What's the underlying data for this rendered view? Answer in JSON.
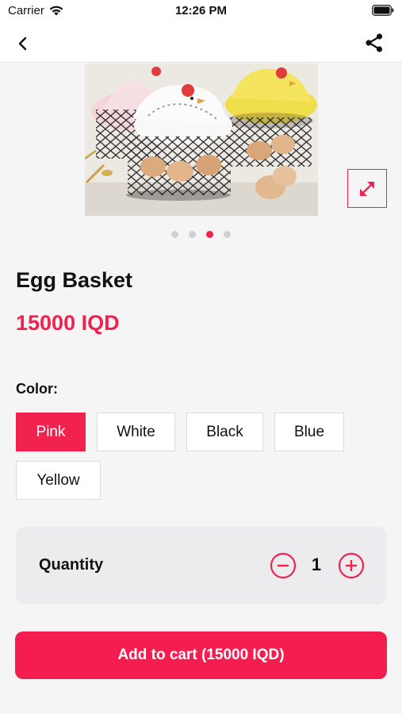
{
  "status_bar": {
    "carrier": "Carrier",
    "time": "12:26 PM"
  },
  "nav": {
    "back_icon": "chevron-left-icon",
    "share_icon": "share-icon"
  },
  "gallery": {
    "image_subject": "egg baskets with hen-shaped lids",
    "total_images": 4,
    "active_image": 3,
    "expand_icon": "expand-diagonal-icon"
  },
  "product": {
    "title": "Egg Basket",
    "price": "15000 IQD"
  },
  "color": {
    "label": "Color:",
    "options": [
      "Pink",
      "White",
      "Black",
      "Blue",
      "Yellow"
    ],
    "selected": "Pink"
  },
  "quantity": {
    "label": "Quantity",
    "value": "1",
    "minus_icon": "minus-circle-icon",
    "plus_icon": "plus-circle-icon"
  },
  "cart": {
    "button_label": "Add to cart (15000 IQD)"
  },
  "theme": {
    "accent": "#f2224f",
    "background": "#f5f5f6",
    "card": "#ececef"
  }
}
